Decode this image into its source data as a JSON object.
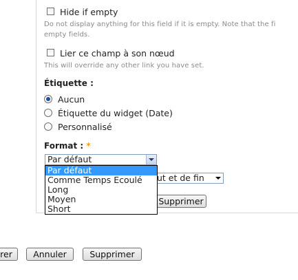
{
  "options": {
    "hide_if_empty": {
      "label": "Hide if empty",
      "description_line1": "Do not display anything for this field if it is empty. Note that the fi",
      "description_line2": "empty fields.",
      "checked": false
    },
    "link_to_node": {
      "label": "Lier ce champ à son nœud",
      "description": "This will override any other link you have set.",
      "checked": false
    }
  },
  "label_section": {
    "heading": "Étiquette :",
    "choices": [
      {
        "label": "Aucun",
        "checked": true
      },
      {
        "label": "Étiquette du widget (Date)",
        "checked": false
      },
      {
        "label": "Personnalisé",
        "checked": false
      }
    ]
  },
  "format_section": {
    "heading": "Format :",
    "required_marker": "*",
    "selected": "Par défaut",
    "dropdown_options": [
      "Par défaut",
      "Comme Temps Ecoulé",
      "Long",
      "Moyen",
      "Short"
    ]
  },
  "second_select": {
    "visible_value": "ut et de fin"
  },
  "panel_delete_button": "Supprimer",
  "footer": {
    "save_partial": "rer",
    "cancel_label": "Annuler",
    "delete_label": "Supprimer"
  },
  "colors": {
    "selection_highlight": "#3399ff",
    "required_star": "#f0a020",
    "description_text": "#8a8a8a"
  }
}
